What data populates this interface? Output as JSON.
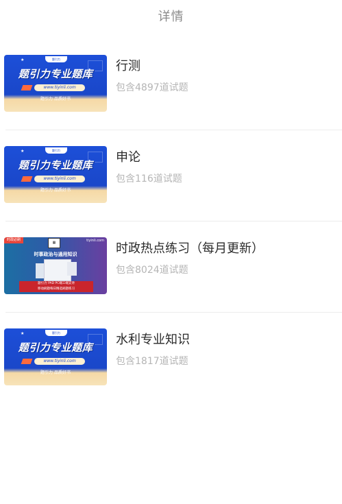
{
  "header": {
    "title": "详情"
  },
  "items": [
    {
      "title": "行测",
      "subtitle": "包含4897道试题",
      "thumb_style": "blue",
      "thumb": {
        "brand": "题引力专业题库",
        "url": "www.tiyinli.com",
        "slogan": "题引力 品质好书",
        "logo": "题引力"
      }
    },
    {
      "title": "申论",
      "subtitle": "包含116道试题",
      "thumb_style": "blue",
      "thumb": {
        "brand": "题引力专业题库",
        "url": "www.tiyinli.com",
        "slogan": "题引力 品质好书",
        "logo": "题引力"
      }
    },
    {
      "title": "时政热点练习（每月更新）",
      "subtitle": "包含8024道试题",
      "thumb_style": "gradient",
      "thumb": {
        "badge": "时政必刷",
        "site": "tiyinli.com",
        "headline": "时事政治与通用知识",
        "banner_line1": "题引力 PAD PC端三端支持",
        "banner_line2": "移动刷题每日精选刷题练习"
      }
    },
    {
      "title": "水利专业知识",
      "subtitle": "包含1817道试题",
      "thumb_style": "blue",
      "thumb": {
        "brand": "题引力专业题库",
        "url": "www.tiyinli.com",
        "slogan": "题引力 品质好书",
        "logo": "题引力"
      }
    }
  ]
}
